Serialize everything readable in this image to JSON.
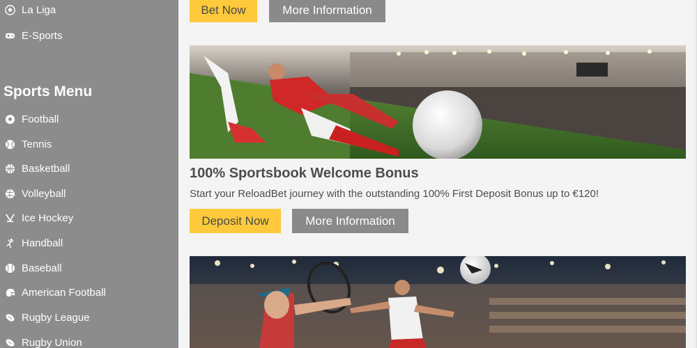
{
  "sidebar": {
    "top_items": [
      {
        "label": "La Liga",
        "icon": "soccer-ball-icon"
      },
      {
        "label": "E-Sports",
        "icon": "gamepad-icon"
      }
    ],
    "sports_menu_title": "Sports Menu",
    "sports_items": [
      {
        "label": "Football",
        "icon": "football-icon"
      },
      {
        "label": "Tennis",
        "icon": "tennis-ball-icon"
      },
      {
        "label": "Basketball",
        "icon": "basketball-icon"
      },
      {
        "label": "Volleyball",
        "icon": "volleyball-icon"
      },
      {
        "label": "Ice Hockey",
        "icon": "hockey-sticks-icon"
      },
      {
        "label": "Handball",
        "icon": "handball-player-icon"
      },
      {
        "label": "Baseball",
        "icon": "baseball-icon"
      },
      {
        "label": "American Football",
        "icon": "american-football-helmet-icon"
      },
      {
        "label": "Rugby League",
        "icon": "rugby-ball-icon"
      },
      {
        "label": "Rugby Union",
        "icon": "rugby-ball-icon"
      }
    ]
  },
  "promo_top": {
    "primary_button": "Bet Now",
    "secondary_button": "More Information"
  },
  "promo_sportsbook": {
    "title": "100% Sportsbook Welcome Bonus",
    "description": "Start your ReloadBet journey with the outstanding 100% First Deposit Bonus up to €120!",
    "primary_button": "Deposit Now",
    "secondary_button": "More Information"
  },
  "colors": {
    "sidebar_bg": "#8c8c8c",
    "accent_yellow": "#ffc93c",
    "button_grey": "#8a8a8a",
    "page_bg": "#f4f4f4"
  }
}
